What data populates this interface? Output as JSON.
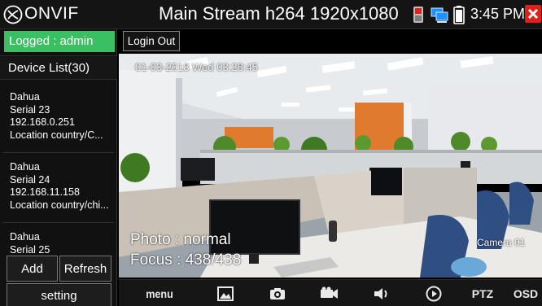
{
  "header": {
    "app_name": "ONVIF",
    "stream_title": "Main Stream h264 1920x1080",
    "time": "3:45 PM"
  },
  "sidebar": {
    "logged": "Logged : admin",
    "device_list": "Device List(30)",
    "devices": [
      {
        "name": "Dahua",
        "serial": "Serial 23",
        "ip": "192.168.0.251",
        "location": "Location country/C..."
      },
      {
        "name": "Dahua",
        "serial": "Serial 24",
        "ip": "192.168.11.158",
        "location": "Location country/chi..."
      },
      {
        "name": "Dahua",
        "serial": "Serial 25"
      }
    ],
    "add_label": "Add",
    "refresh_label": "Refresh",
    "setting_label": "setting"
  },
  "video": {
    "login_out_label": "Login Out",
    "timestamp": "01-03-2018 Wed 03:28:45",
    "photo": "Photo : normal",
    "focus": "Focus : 438/438",
    "camera_name": "Camera 01"
  },
  "toolbar": {
    "menu_label": "menu",
    "ptz_label": "PTZ",
    "osd_label": "OSD"
  },
  "colors": {
    "accent_green": "#3bbf63",
    "close_red": "#e0211b"
  }
}
